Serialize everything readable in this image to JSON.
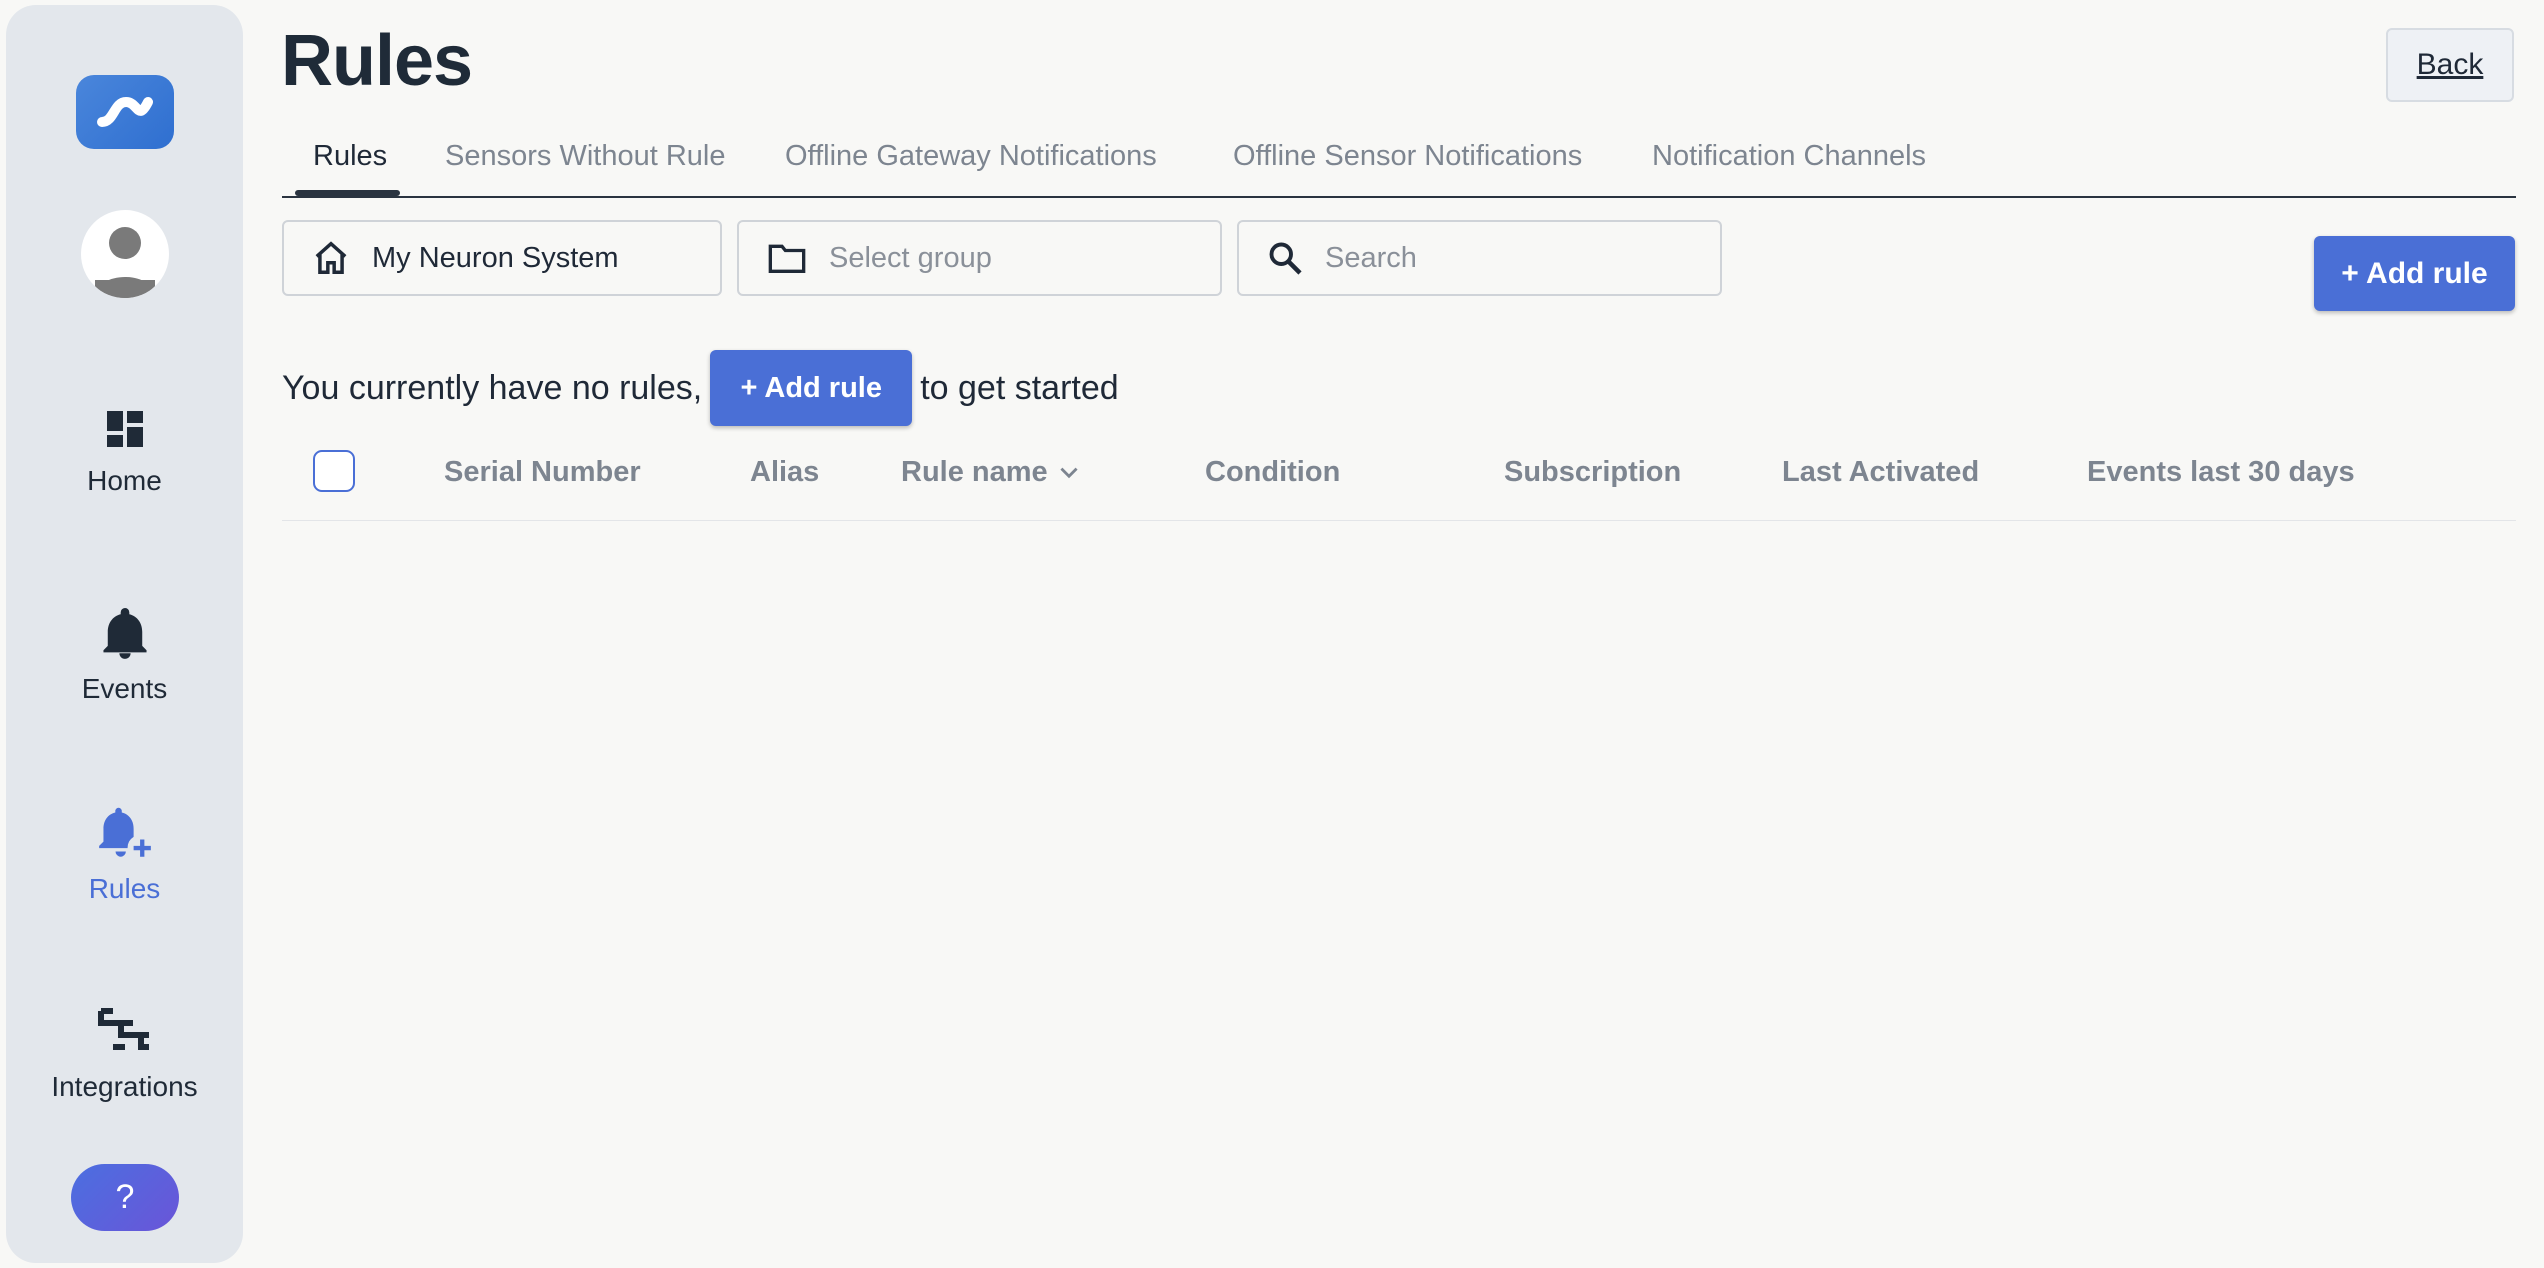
{
  "sidebar": {
    "items": [
      {
        "label": "Home",
        "icon": "dashboard-icon"
      },
      {
        "label": "Events",
        "icon": "bell-icon"
      },
      {
        "label": "Rules",
        "icon": "bell-plus-icon"
      },
      {
        "label": "Integrations",
        "icon": "integrations-icon"
      }
    ],
    "help_label": "?",
    "active": "Rules"
  },
  "header": {
    "title": "Rules",
    "back_label": "Back"
  },
  "tabs": [
    {
      "label": "Rules"
    },
    {
      "label": "Sensors Without Rule"
    },
    {
      "label": "Offline Gateway Notifications"
    },
    {
      "label": "Offline Sensor Notifications"
    },
    {
      "label": "Notification Channels"
    }
  ],
  "filters": {
    "system": "My Neuron System",
    "group_placeholder": "Select group",
    "search_placeholder": "Search"
  },
  "actions": {
    "add_rule_label": "+ Add rule"
  },
  "empty_state": {
    "prefix": "You currently have no rules,",
    "button_label": "+ Add rule",
    "suffix": "to get started"
  },
  "table": {
    "columns": [
      "Serial Number",
      "Alias",
      "Rule name",
      "Condition",
      "Subscription",
      "Last Activated",
      "Events last 30 days"
    ]
  },
  "colors": {
    "accent": "#4a6fd6",
    "sidebar_bg": "#e3e7ec",
    "page_bg": "#f8f8f6"
  }
}
